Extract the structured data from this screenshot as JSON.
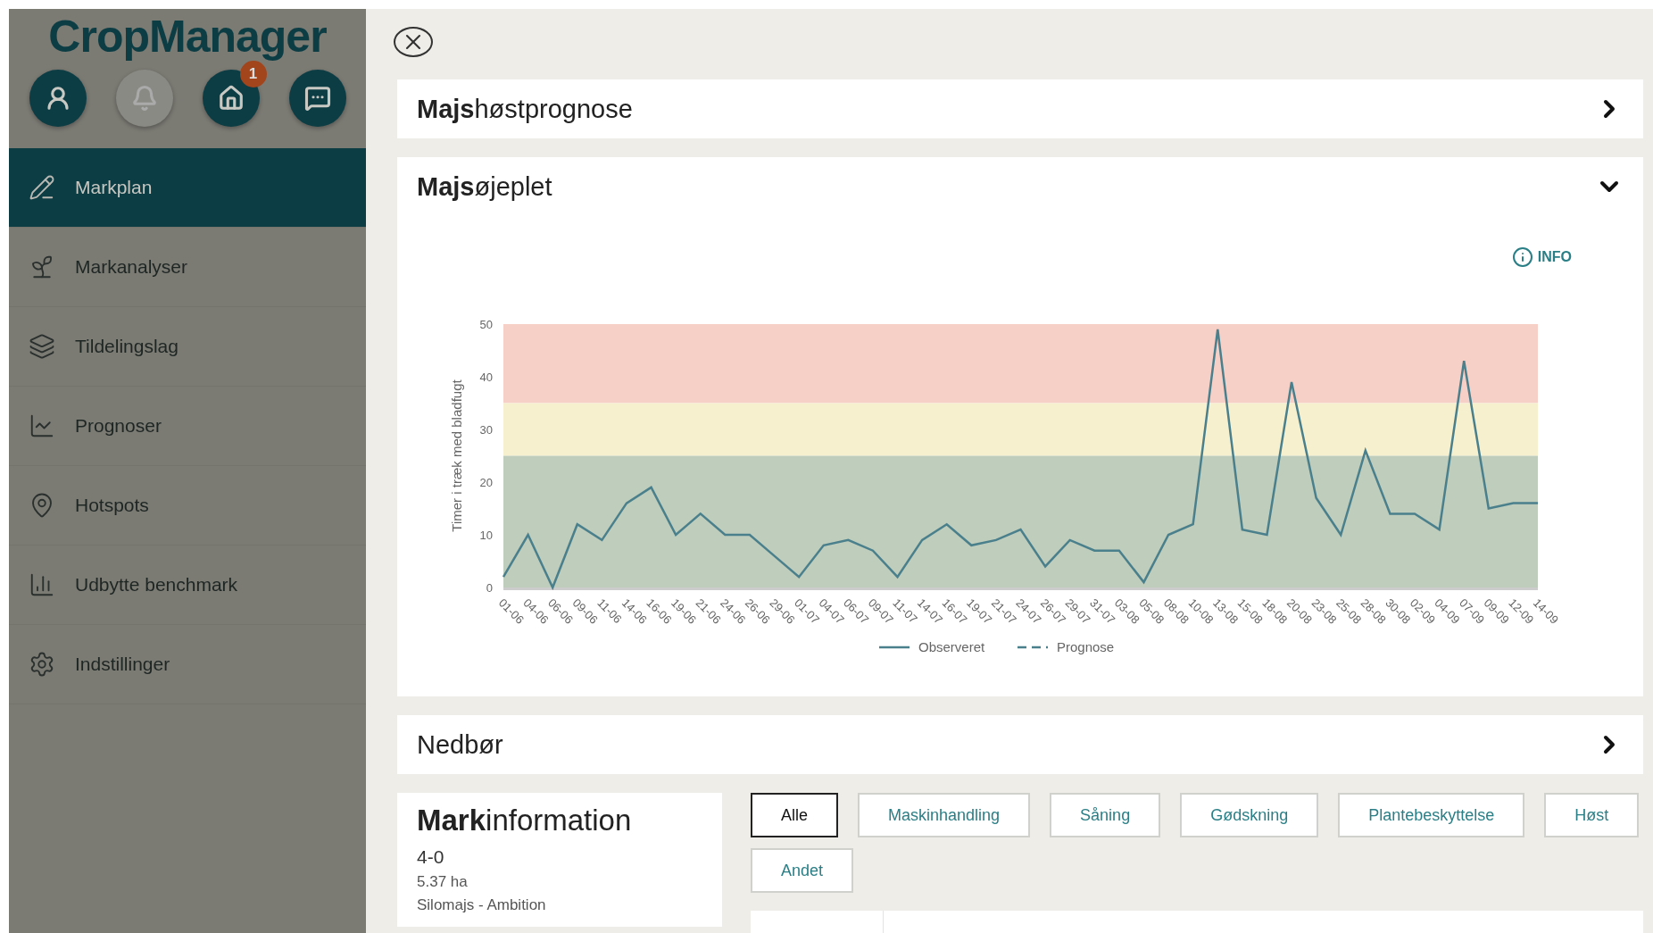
{
  "sidebar": {
    "logo": "CropManager",
    "round_buttons": [
      {
        "kind": "user",
        "disabled": false
      },
      {
        "kind": "bell",
        "disabled": true
      },
      {
        "kind": "home",
        "disabled": false,
        "badge": "1"
      },
      {
        "kind": "chat",
        "disabled": false
      }
    ],
    "items": [
      {
        "kind": "plan",
        "label": "Markplan",
        "selected": true
      },
      {
        "kind": "analysis",
        "label": "Markanalyser",
        "selected": false
      },
      {
        "kind": "layers",
        "label": "Tildelingslag",
        "selected": false
      },
      {
        "kind": "forecast",
        "label": "Prognoser",
        "selected": false
      },
      {
        "kind": "pin",
        "label": "Hotspots",
        "selected": false
      },
      {
        "kind": "yield",
        "label": "Udbytte benchmark",
        "selected": false
      },
      {
        "kind": "settings",
        "label": "Indstillinger",
        "selected": false
      }
    ]
  },
  "panels": [
    {
      "title": "**Majs**høstprognose",
      "expanded": false
    },
    {
      "title": "**Majs**øjeplet",
      "expanded": true,
      "info": "INFO",
      "chart_data": {
        "type": "line",
        "ylabel": "Timer i træk med bladfugt",
        "ylim": [
          0,
          50
        ],
        "yticks": [
          0,
          10,
          20,
          30,
          40,
          50
        ],
        "categories": [
          "01-06",
          "04-06",
          "06-06",
          "09-06",
          "11-06",
          "14-06",
          "16-06",
          "19-06",
          "21-06",
          "24-06",
          "26-06",
          "29-06",
          "01-07",
          "04-07",
          "06-07",
          "09-07",
          "11-07",
          "14-07",
          "16-07",
          "19-07",
          "21-07",
          "24-07",
          "26-07",
          "29-07",
          "31-07",
          "03-08",
          "05-08",
          "08-08",
          "10-08",
          "13-08",
          "15-08",
          "18-08",
          "20-08",
          "23-08",
          "25-08",
          "28-08",
          "30-08",
          "02-09",
          "04-09",
          "07-09",
          "09-09",
          "12-09",
          "14-09"
        ],
        "series": [
          {
            "name": "Observeret",
            "color": "#4a7f8c",
            "values": [
              2,
              10,
              0,
              12,
              9,
              16,
              19,
              10,
              14,
              10,
              10,
              6,
              2,
              8,
              9,
              7,
              2,
              9,
              12,
              8,
              9,
              11,
              4,
              9,
              7,
              7,
              1,
              10,
              12,
              49,
              11,
              10,
              39,
              17,
              10,
              26,
              14,
              14,
              11,
              43,
              15,
              16,
              16
            ]
          },
          {
            "name": "Prognose",
            "color": "#4a7f8c",
            "values": [
              null,
              null,
              null,
              null,
              null,
              null,
              null,
              null,
              null,
              null,
              null,
              null,
              null,
              null,
              null,
              null,
              null,
              null,
              null,
              null,
              null,
              null,
              null,
              null,
              null,
              null,
              null,
              null,
              null,
              null,
              null,
              null,
              null,
              null,
              null,
              null,
              null,
              null,
              null,
              null,
              null,
              null,
              null
            ]
          }
        ],
        "bands": [
          {
            "axis": "y",
            "from": 35,
            "to": 50,
            "color": "#f6cfc6"
          },
          {
            "axis": "y",
            "from": 25,
            "to": 35,
            "color": "#f6f0cf"
          },
          {
            "axis": "y",
            "from": 0,
            "to": 25,
            "color": "#bfcdbc"
          }
        ]
      }
    },
    {
      "title": "Nedbør",
      "expanded": false
    }
  ],
  "field_info": {
    "title": "**Mark**information",
    "name": "4-0",
    "area": "5.37 ha",
    "crop": "Silomajs - Ambition"
  },
  "filters": [
    {
      "label": "Alle",
      "selected": true
    },
    {
      "label": "Maskinhandling",
      "selected": false
    },
    {
      "label": "Såning",
      "selected": false
    },
    {
      "label": "Gødskning",
      "selected": false
    },
    {
      "label": "Plantebeskyttelse",
      "selected": false
    },
    {
      "label": "Høst",
      "selected": false
    },
    {
      "label": "Andet",
      "selected": false
    }
  ]
}
